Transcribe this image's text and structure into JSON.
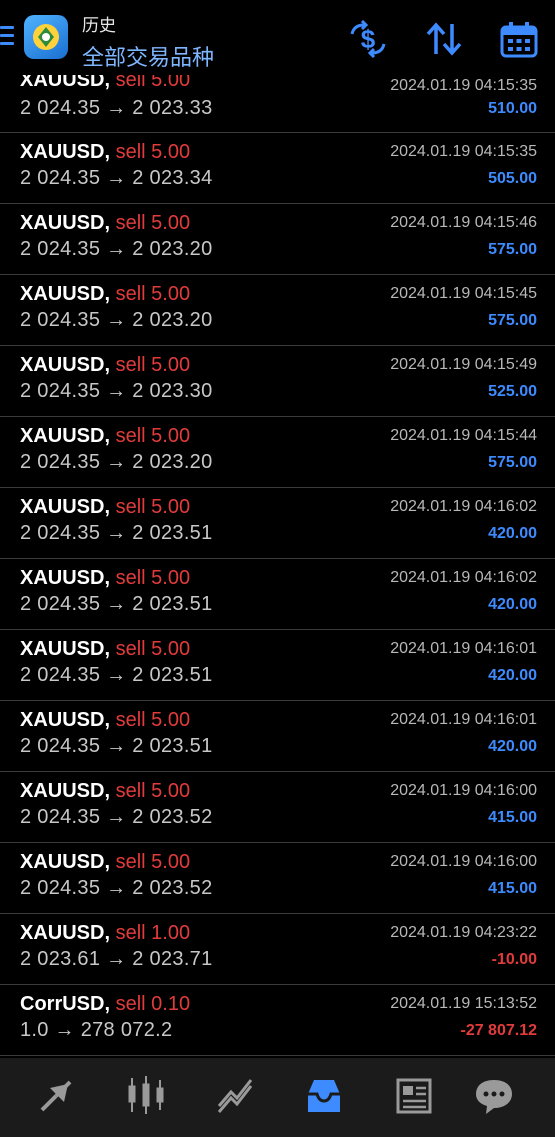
{
  "header": {
    "subtitle": "历史",
    "title": "全部交易品种",
    "icons": [
      "menu-icon",
      "app-logo",
      "currency-swap-icon",
      "sort-icon",
      "calendar-icon"
    ]
  },
  "trades": [
    {
      "symbol": "XAUUSD,",
      "side": "sell 5.00",
      "prices": "2 024.35 → 2 023.33",
      "time": "2024.01.19 04:15:35",
      "profit": "510.00",
      "negative": false
    },
    {
      "symbol": "XAUUSD,",
      "side": "sell 5.00",
      "prices": "2 024.35 → 2 023.34",
      "time": "2024.01.19 04:15:35",
      "profit": "505.00",
      "negative": false
    },
    {
      "symbol": "XAUUSD,",
      "side": "sell 5.00",
      "prices": "2 024.35 → 2 023.20",
      "time": "2024.01.19 04:15:46",
      "profit": "575.00",
      "negative": false
    },
    {
      "symbol": "XAUUSD,",
      "side": "sell 5.00",
      "prices": "2 024.35 → 2 023.20",
      "time": "2024.01.19 04:15:45",
      "profit": "575.00",
      "negative": false
    },
    {
      "symbol": "XAUUSD,",
      "side": "sell 5.00",
      "prices": "2 024.35 → 2 023.30",
      "time": "2024.01.19 04:15:49",
      "profit": "525.00",
      "negative": false
    },
    {
      "symbol": "XAUUSD,",
      "side": "sell 5.00",
      "prices": "2 024.35 → 2 023.20",
      "time": "2024.01.19 04:15:44",
      "profit": "575.00",
      "negative": false
    },
    {
      "symbol": "XAUUSD,",
      "side": "sell 5.00",
      "prices": "2 024.35 → 2 023.51",
      "time": "2024.01.19 04:16:02",
      "profit": "420.00",
      "negative": false
    },
    {
      "symbol": "XAUUSD,",
      "side": "sell 5.00",
      "prices": "2 024.35 → 2 023.51",
      "time": "2024.01.19 04:16:02",
      "profit": "420.00",
      "negative": false
    },
    {
      "symbol": "XAUUSD,",
      "side": "sell 5.00",
      "prices": "2 024.35 → 2 023.51",
      "time": "2024.01.19 04:16:01",
      "profit": "420.00",
      "negative": false
    },
    {
      "symbol": "XAUUSD,",
      "side": "sell 5.00",
      "prices": "2 024.35 → 2 023.51",
      "time": "2024.01.19 04:16:01",
      "profit": "420.00",
      "negative": false
    },
    {
      "symbol": "XAUUSD,",
      "side": "sell 5.00",
      "prices": "2 024.35 → 2 023.52",
      "time": "2024.01.19 04:16:00",
      "profit": "415.00",
      "negative": false
    },
    {
      "symbol": "XAUUSD,",
      "side": "sell 5.00",
      "prices": "2 024.35 → 2 023.52",
      "time": "2024.01.19 04:16:00",
      "profit": "415.00",
      "negative": false
    },
    {
      "symbol": "XAUUSD,",
      "side": "sell 1.00",
      "prices": "2 023.61 → 2 023.71",
      "time": "2024.01.19 04:23:22",
      "profit": "-10.00",
      "negative": true
    },
    {
      "symbol": "CorrUSD,",
      "side": "sell 0.10",
      "prices": "1.0 → 278 072.2",
      "time": "2024.01.19 15:13:52",
      "profit": "-27 807.12",
      "negative": true
    }
  ],
  "tabbar": {
    "tabs": [
      {
        "icon": "quotes-icon",
        "active": false
      },
      {
        "icon": "chart-icon",
        "active": false
      },
      {
        "icon": "trade-icon",
        "active": false
      },
      {
        "icon": "history-icon",
        "active": true
      },
      {
        "icon": "news-icon",
        "active": false
      },
      {
        "icon": "chat-icon",
        "active": false
      }
    ]
  },
  "colors": {
    "accent": "#3d8bff",
    "negative": "#e23b3b",
    "background": "#000000",
    "tabbar": "#1b1b1b"
  }
}
